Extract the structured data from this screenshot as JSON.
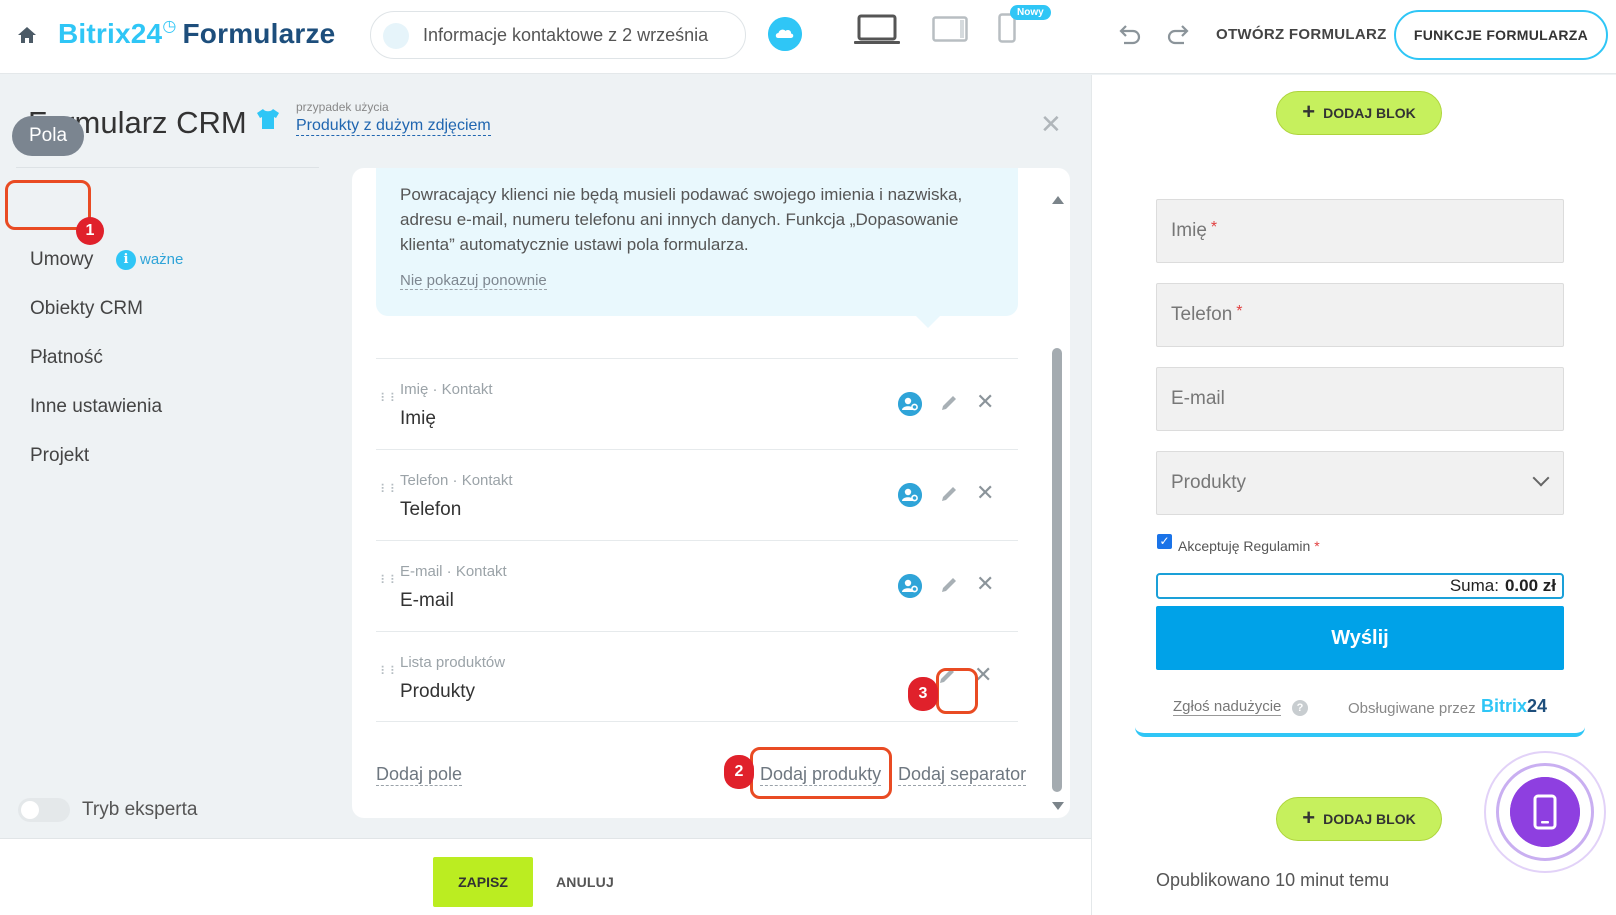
{
  "header": {
    "logo_main": "Bitrix24",
    "logo_suffix": "Formularze",
    "form_title": "Informacje kontaktowe z 2 września",
    "new_badge": "Nowy",
    "open_form": "OTWÓRZ FORMULARZ",
    "form_functions": "FUNKCJE FORMULARZA"
  },
  "panel": {
    "title": "Formularz CRM",
    "usecase_label": "przypadek użycia",
    "usecase_value": "Produkty z dużym zdjęciem"
  },
  "nav": {
    "items": [
      {
        "label": "Pola",
        "active": true
      },
      {
        "label": "Umowy"
      },
      {
        "label": "Obiekty CRM"
      },
      {
        "label": "Płatność"
      },
      {
        "label": "Inne ustawienia"
      },
      {
        "label": "Projekt"
      }
    ],
    "important_label": "ważne",
    "expert_mode": "Tryb eksperta"
  },
  "info": {
    "text": "Powracający klienci nie będą musieli podawać swojego imienia i nazwiska, adresu e-mail, numeru telefonu ani innych danych. Funkcja „Dopasowanie klienta” automatycznie ustawi pola formularza.",
    "dont_show": "Nie pokazuj ponownie"
  },
  "fields": [
    {
      "meta": "Imię · Kontakt",
      "name": "Imię"
    },
    {
      "meta": "Telefon · Kontakt",
      "name": "Telefon"
    },
    {
      "meta": "E-mail · Kontakt",
      "name": "E-mail"
    },
    {
      "meta": "Lista produktów",
      "name": "Produkty"
    }
  ],
  "actions": {
    "add_field": "Dodaj pole",
    "add_products": "Dodaj produkty",
    "add_separator": "Dodaj separator"
  },
  "annotations": [
    "1",
    "2",
    "3"
  ],
  "footer": {
    "save": "ZAPISZ",
    "cancel": "ANULUJ"
  },
  "preview": {
    "add_block": "DODAJ BLOK",
    "fields": [
      {
        "label": "Imię",
        "required": true
      },
      {
        "label": "Telefon",
        "required": true
      },
      {
        "label": "E-mail",
        "required": false
      },
      {
        "label": "Produkty",
        "required": false
      }
    ],
    "accept": "Akceptuję Regulamin",
    "sum_label": "Suma:",
    "sum_value": "0.00 zł",
    "send": "Wyślij",
    "report": "Zgłoś nadużycie",
    "powered_by": "Obsługiwane przez",
    "powered_logo_a": "Bitrix",
    "powered_logo_b": "24",
    "published": "Opublikowano 10 minut temu"
  },
  "colors": {
    "accent": "#2fc6f6",
    "annotation": "#e94b23",
    "save": "#bbed21",
    "send": "#00a2e8",
    "add_block": "#c6f05d",
    "mobile": "#8e3fe0"
  }
}
